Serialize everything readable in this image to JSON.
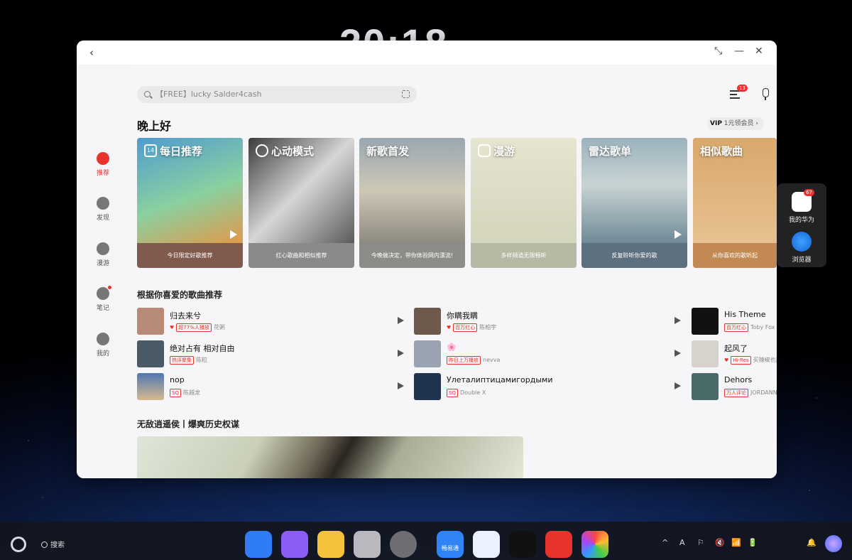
{
  "desktop": {
    "clock": "20:18"
  },
  "window": {
    "back_label": "‹",
    "controls": [
      "⤡",
      "—",
      "✕"
    ]
  },
  "sidebar": {
    "items": [
      {
        "label": "推荐",
        "icon": "netease-logo-icon",
        "active": true
      },
      {
        "label": "发现",
        "icon": "compass-icon"
      },
      {
        "label": "漫游",
        "icon": "roam-icon"
      },
      {
        "label": "笔记",
        "icon": "notes-icon",
        "dot": true
      },
      {
        "label": "我的",
        "icon": "user-icon"
      }
    ]
  },
  "header": {
    "search_placeholder": "【FREE】lucky Salder4cash",
    "message_badge": "13",
    "greeting": "晚上好",
    "vip_label": "VIP",
    "vip_text": "1元领会员"
  },
  "cards": [
    {
      "title": "每日推荐",
      "caption": "今日限定好歌推荐",
      "icon_text": "14",
      "color": "#7f5a4d",
      "art": "#5fa6c9"
    },
    {
      "title": "心动模式",
      "caption": "红心歌曲和相似推荐",
      "color": "#8a8a8a",
      "art": "#6b6b6b"
    },
    {
      "title": "新歌首发",
      "caption": "今晚做决定，带你体验网内漂流!",
      "color": "#8d8c88",
      "art": "#b9b7ae"
    },
    {
      "title": "漫游",
      "caption": "多样频道无限畅听",
      "color": "#b8b9a4",
      "art": "#dcdcc6"
    },
    {
      "title": "雷达歌单",
      "caption": "反复聆听你爱的歌",
      "color": "#5d7080",
      "art": "#8ba2ad"
    },
    {
      "title": "相似歌曲",
      "caption": "从你喜欢的歌听起",
      "color": "#c28a52",
      "art": "#e0b27a"
    }
  ],
  "recommend": {
    "title": "根据你喜爱的歌曲推荐",
    "songs": [
      {
        "title": "归去来兮",
        "tag": "超77%人播放",
        "artist": "花粥",
        "cover": "#b78a78"
      },
      {
        "title": "绝对占有 相对自由",
        "tag": "热评聚集",
        "artist": "陈粒",
        "cover": "#4a5a66"
      },
      {
        "title": "nop",
        "tag": "SQ",
        "artist": "陈越龙",
        "cover": "#3e6da8"
      },
      {
        "title": "你瞒我瞒",
        "tag": "百万红心",
        "artist": "陈柏宇",
        "cover": "#6d5a4c"
      },
      {
        "title": "🌸",
        "tag": "昨日上万播放",
        "artist": "nevva",
        "cover": "#9aa3b2"
      },
      {
        "title": "Улеталиптицамигордыми",
        "tag": "SQ",
        "artist": "Double X",
        "cover": "#1f3450"
      },
      {
        "title": "His Theme",
        "tag": "百万红心",
        "artist": "Toby Fox",
        "cover": "#111111"
      },
      {
        "title": "起风了",
        "tag": "Hi-Res",
        "artist": "买辣椒也用券",
        "cover": "#d8d2cc"
      },
      {
        "title": "Dehors",
        "tag": "万人评论",
        "artist": "JORDANN",
        "cover": "#4b6b6b"
      }
    ]
  },
  "section2": {
    "title": "无敌逍遥侯丨爆爽历史权谋"
  },
  "side_dock": {
    "apps": [
      {
        "label": "我的华为",
        "badge": "67"
      },
      {
        "label": "浏览器"
      }
    ]
  },
  "taskbar": {
    "search_label": "搜索",
    "apps": [
      {
        "name": "app-grid",
        "color": "#2f7cf6"
      },
      {
        "name": "files-purple",
        "color": "#8b5cf6"
      },
      {
        "name": "files",
        "color": "#f5c13a"
      },
      {
        "name": "trash",
        "color": "#b8b8be"
      },
      {
        "name": "settings",
        "color": "#6e6e74"
      },
      {
        "name": "store",
        "color": "#2f84f7",
        "label": "畅易通"
      },
      {
        "name": "qq-music",
        "color": "#eaf1ff"
      },
      {
        "name": "douyin",
        "color": "#111111"
      },
      {
        "name": "netease-music",
        "color": "#e8332d"
      },
      {
        "name": "photos",
        "color": "#ffffff"
      }
    ],
    "tray": [
      "^",
      "A",
      "⚐",
      "🔇",
      "📶",
      "🔋",
      "🔔"
    ]
  }
}
